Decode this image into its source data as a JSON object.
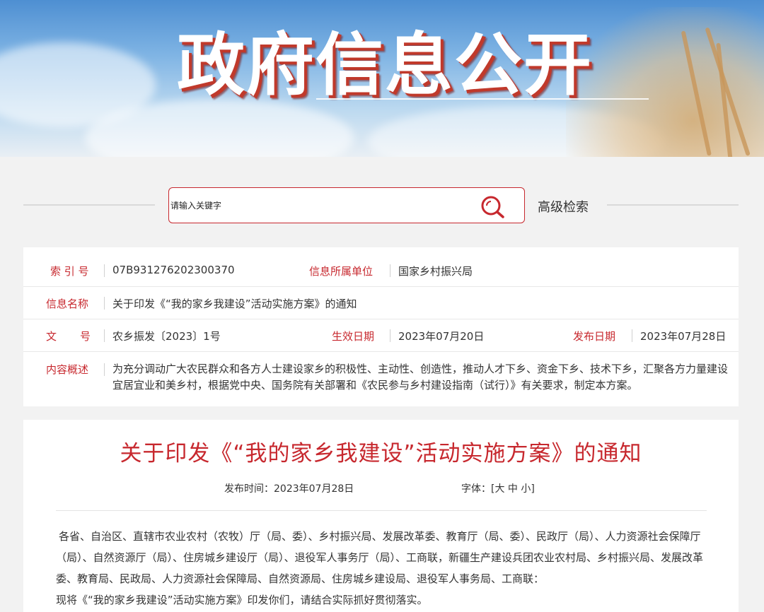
{
  "banner": {
    "title": "政府信息公开"
  },
  "search": {
    "placeholder": "请输入关键字",
    "advanced_label": "高级检索"
  },
  "meta": {
    "index_label": "索 引 号",
    "index_value": "07B931276202300370",
    "unit_label": "信息所属单位",
    "unit_value": "国家乡村振兴局",
    "name_label": "信息名称",
    "name_value": "关于印发《“我的家乡我建设”活动实施方案》的通知",
    "doc_label_1": "文",
    "doc_label_2": "号",
    "doc_value": "农乡振发〔2023〕1号",
    "effective_label": "生效日期",
    "effective_value": "2023年07月20日",
    "publish_label": "发布日期",
    "publish_value": "2023年07月28日",
    "summary_label": "内容概述",
    "summary_value": "为充分调动广大农民群众和各方人士建设家乡的积极性、主动性、创造性，推动人才下乡、资金下乡、技术下乡，汇聚各方力量建设宜居宜业和美乡村，根据党中央、国务院有关部署和《农民参与乡村建设指南（试行）》有关要求，制定本方案。"
  },
  "article": {
    "title": "关于印发《“我的家乡我建设”活动实施方案》的通知",
    "publish_time": "发布时间：2023年07月28日",
    "font_size_label": "字体：[大 中 小]",
    "paragraph_1": "各省、自治区、直辖市农业农村（农牧）厅（局、委）、乡村振兴局、发展改革委、教育厅（局、委）、民政厅（局）、人力资源社会保障厅（局）、自然资源厅（局）、住房城乡建设厅（局）、退役军人事务厅（局）、工商联，新疆生产建设兵团农业农村局、乡村振兴局、发展改革委、教育局、民政局、人力资源社会保障局、自然资源局、住房城乡建设局、退役军人事务局、工商联：",
    "paragraph_2": "现将《“我的家乡我建设”活动实施方案》印发你们，请结合实际抓好贯彻落实。"
  },
  "colors": {
    "accent": "#c7282e",
    "background": "#f2f2f2"
  },
  "icons": {
    "search": "search-icon"
  }
}
